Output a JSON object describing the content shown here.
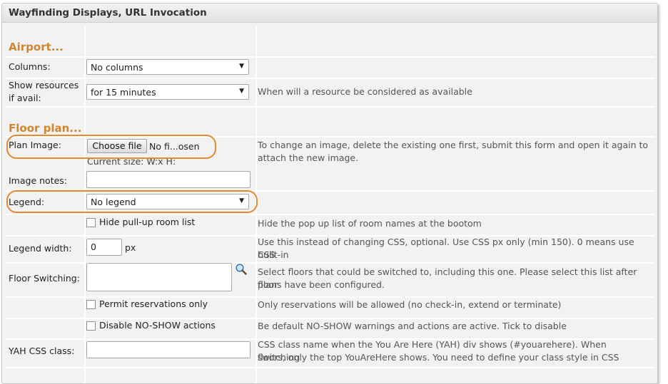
{
  "panel": {
    "title": "Wayfinding Displays, URL Invocation"
  },
  "airport": {
    "heading": "Airport...",
    "columns": {
      "label": "Columns:",
      "value": "No columns"
    },
    "show_resources": {
      "label_line1": "Show resources",
      "label_line2": "if avail:",
      "value": "for 15 minutes",
      "desc": "When will a resource be considered as available"
    }
  },
  "floor_plan": {
    "heading": "Floor plan...",
    "plan_image": {
      "label": "Plan Image:",
      "button": "Choose file",
      "file_status": "No fi...osen",
      "current_size": "Current size: W:x H:",
      "desc_line1": "To change an image, delete the existing one first, submit this form and open it again to",
      "desc_line2": "attach the new image."
    },
    "image_notes": {
      "label": "Image notes:",
      "value": ""
    },
    "legend": {
      "label": "Legend:",
      "value": "No legend"
    },
    "hide_pullup": {
      "label": "Hide pull-up room list",
      "checked": false,
      "desc": "Hide the pop up list of room names at the bootom"
    },
    "legend_width": {
      "label": "Legend width:",
      "value": "0",
      "unit": "px",
      "desc_line1": "Use this instead of changing CSS, optional. Use CSS px only (min 150). 0 means use built-in",
      "desc_line2": "CSS"
    },
    "floor_switching": {
      "label": "Floor Switching:",
      "desc_line1": "Select floors that could be switched to, including this one. Please select this list after floor",
      "desc_line2": "plans have been configured."
    },
    "permit_reservations": {
      "label": "Permit reservations only",
      "checked": false,
      "desc": "Only reservations will be allowed (no check-in, extend or terminate)"
    },
    "disable_noshow": {
      "label": "Disable NO-SHOW actions",
      "checked": false,
      "desc": "Be default NO-SHOW warnings and actions are active. Tick to disable"
    },
    "yah_css": {
      "label": "YAH CSS class:",
      "value": "",
      "desc_line1": "CSS class name when the You Are Here (YAH) div shows (#youarehere).  When switching",
      "desc_line2": "floors, only the top YouAreHere shows. You need to define your class style in CSS"
    }
  },
  "colors": {
    "accent": "#d0852f",
    "highlight_ring": "#e38a33"
  },
  "icons": {
    "select_arrow": "chevron-down-icon",
    "search": "search-icon"
  }
}
